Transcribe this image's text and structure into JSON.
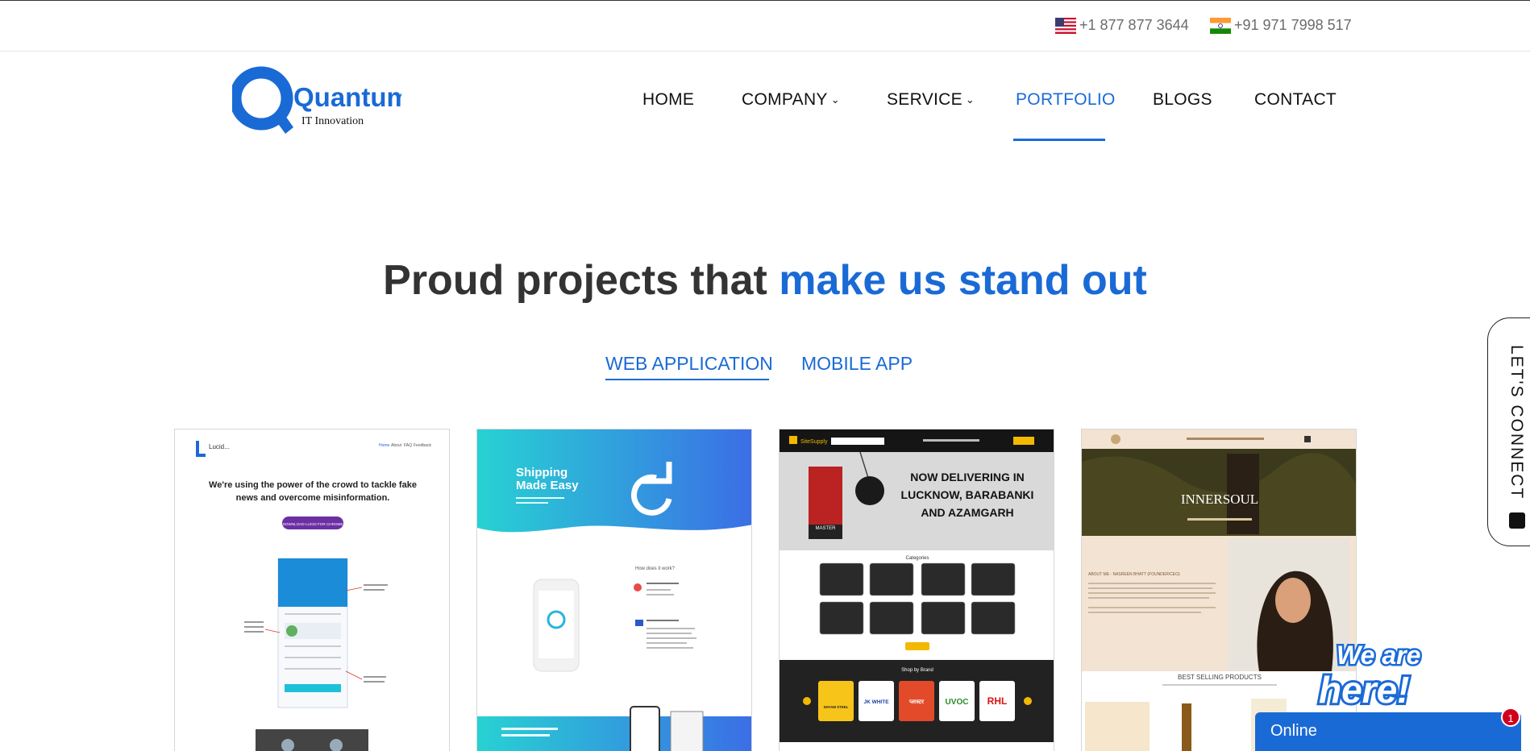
{
  "topbar": {
    "phones": [
      {
        "country": "US",
        "number": "+1 877 877 3644"
      },
      {
        "country": "IN",
        "number": "+91 971 7998 517"
      }
    ]
  },
  "logo": {
    "brand": "Quantum",
    "tagline": "IT Innovation"
  },
  "nav": {
    "items": [
      {
        "label": "HOME"
      },
      {
        "label": "COMPANY"
      },
      {
        "label": "SERVICE"
      },
      {
        "label": "PORTFOLIO"
      },
      {
        "label": "BLOGS"
      },
      {
        "label": "CONTACT"
      }
    ],
    "active": "PORTFOLIO"
  },
  "headline": {
    "part1": "Proud projects that ",
    "part2": "make us stand out"
  },
  "tabs": {
    "web": "WEB APPLICATION",
    "mobile": "MOBILE APP",
    "active": "WEB APPLICATION"
  },
  "cards": [
    {
      "brand": "Lucid...",
      "nav": [
        "Home",
        "About",
        "FAQ",
        "Feedback"
      ],
      "heading1": "We're using the power of the crowd to tackle fake",
      "heading2": "news and overcome misinformation.",
      "cta": "DOWNLOAD LUCID FOR CHROME"
    },
    {
      "title1": "Shipping",
      "title2": "Made Easy",
      "subtitle": "How does it work?"
    },
    {
      "brand": "SiteSupply",
      "banner1": "NOW DELIVERING IN",
      "banner2": "LUCKNOW, BARABANKI",
      "banner3": "AND AZAMGARH",
      "product": "MASTER",
      "categories_label": "Categories",
      "brands_label": "Shop by Brand",
      "brands": [
        "SHYAM STEEL",
        "JK WHITE",
        "प्लास्टर",
        "UVOC",
        "RHL"
      ]
    },
    {
      "hero": "INNERSOUL",
      "about": "ABOUT ME - NASREEN BHATT (FOUNDER/CEO)",
      "products_label": "BEST SELLING PRODUCTS"
    }
  ],
  "connect": {
    "label": "LET'S CONNECT"
  },
  "chat": {
    "tagline1": "We are",
    "tagline2": "here!",
    "status": "Online",
    "badge": "1"
  },
  "colors": {
    "accent": "#1a6ad6",
    "text": "#222222",
    "chat_badge": "#d0021b"
  }
}
